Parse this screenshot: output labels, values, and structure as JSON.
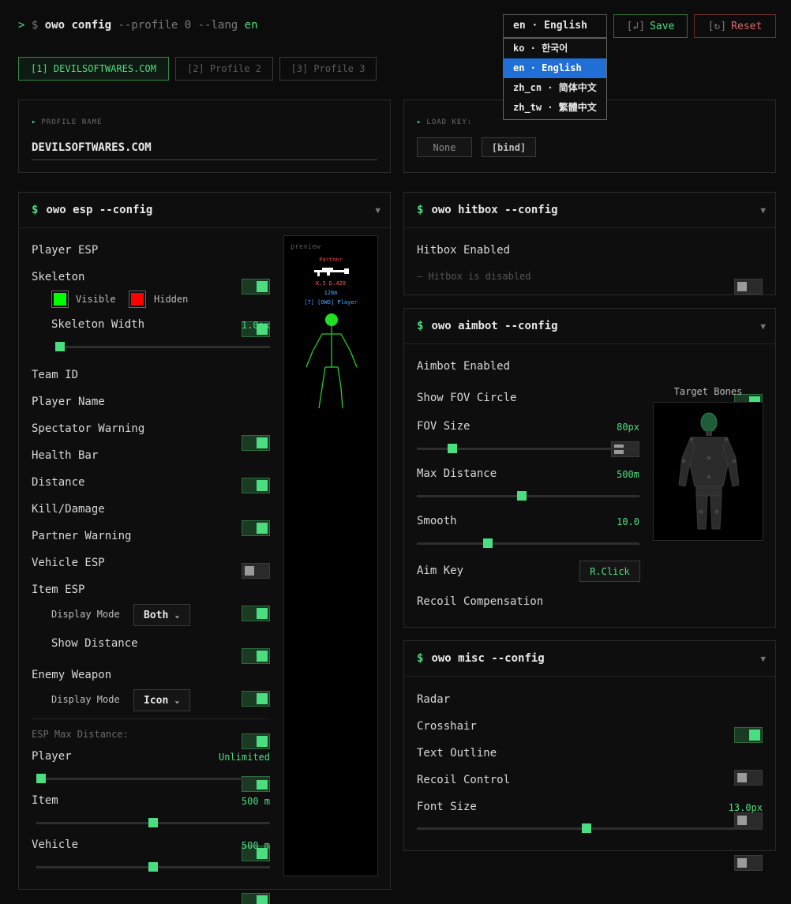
{
  "command": {
    "prompt": ">",
    "dollar": "$",
    "cmd": "owo config",
    "flags": "--profile 0 --lang",
    "lang": "en"
  },
  "language": {
    "current": "en · English",
    "options": [
      {
        "label": "ko · 한국어",
        "selected": false
      },
      {
        "label": "en · English",
        "selected": true
      },
      {
        "label": "zh_cn · 简体中文",
        "selected": false
      },
      {
        "label": "zh_tw · 繁體中文",
        "selected": false
      }
    ]
  },
  "actions": {
    "save_icon": "[↲]",
    "save_label": "Save",
    "reset_icon": "[↻]",
    "reset_label": "Reset"
  },
  "profile_tabs": [
    "[1] DEVILSOFTWARES.COM",
    "[2] Profile 2",
    "[3] Profile 3"
  ],
  "profile": {
    "name_label": "PROFILE NAME",
    "name_value": "DEVILSOFTWARES.COM",
    "load_key_label": "LOAD KEY:",
    "load_key_value": "None",
    "bind_label": "[bind]"
  },
  "esp": {
    "title": "owo esp --config",
    "items": {
      "player_esp": {
        "label": "Player ESP",
        "on": true
      },
      "skeleton": {
        "label": "Skeleton",
        "on": true
      },
      "team_id": {
        "label": "Team ID",
        "on": true
      },
      "player_name": {
        "label": "Player Name",
        "on": true
      },
      "spectator_warning": {
        "label": "Spectator Warning",
        "on": true
      },
      "health_bar": {
        "label": "Health Bar",
        "on": false
      },
      "distance": {
        "label": "Distance",
        "on": true
      },
      "kill_damage": {
        "label": "Kill/Damage",
        "on": true
      },
      "partner_warning": {
        "label": "Partner Warning",
        "on": true
      },
      "vehicle_esp": {
        "label": "Vehicle ESP",
        "on": true
      },
      "item_esp": {
        "label": "Item ESP",
        "on": true
      },
      "show_distance": {
        "label": "Show Distance",
        "on": true
      },
      "enemy_weapon": {
        "label": "Enemy Weapon",
        "on": true
      }
    },
    "visible_label": "Visible",
    "visible_color": "#00ff00",
    "hidden_label": "Hidden",
    "hidden_color": "#ff0000",
    "skeleton_width_label": "Skeleton Width",
    "skeleton_width_value": "1.0px",
    "skeleton_width_fraction": 0.0,
    "display_mode_label": "Display Mode",
    "item_display_mode": "Both",
    "weapon_display_mode": "Icon",
    "max_distance_label": "ESP Max Distance:",
    "player_dist_label": "Player",
    "player_dist_value": "Unlimited",
    "player_dist_fraction": 0.0,
    "item_dist_label": "Item",
    "item_dist_value": "500 m",
    "item_dist_fraction": 0.5,
    "vehicle_dist_label": "Vehicle",
    "vehicle_dist_value": "500 m",
    "vehicle_dist_fraction": 0.5
  },
  "preview": {
    "label": "preview",
    "partner": "Partner",
    "kd": "K.5 D.420",
    "distance": "128m",
    "player": "[7] [OWO] Player"
  },
  "hitbox": {
    "title": "owo hitbox --config",
    "enabled_label": "Hitbox Enabled",
    "enabled": false,
    "status": "— Hitbox is disabled"
  },
  "aimbot": {
    "title": "owo aimbot --config",
    "enabled_label": "Aimbot Enabled",
    "enabled": true,
    "fov_circle_label": "Show FOV Circle",
    "fov_circle": false,
    "fov_size_label": "FOV Size",
    "fov_size_value": "80px",
    "fov_size_fraction": 0.16,
    "max_distance_label": "Max Distance",
    "max_distance_value": "500m",
    "max_distance_fraction": 0.47,
    "smooth_label": "Smooth",
    "smooth_value": "10.0",
    "smooth_fraction": 0.32,
    "aim_key_label": "Aim Key",
    "aim_key_value": "R.Click",
    "recoil_label": "Recoil Compensation",
    "recoil": true,
    "target_bones_label": "Target Bones"
  },
  "misc": {
    "title": "owo misc --config",
    "radar_label": "Radar",
    "radar": true,
    "crosshair_label": "Crosshair",
    "crosshair": false,
    "text_outline_label": "Text Outline",
    "text_outline": false,
    "recoil_control_label": "Recoil Control",
    "recoil_control": false,
    "font_size_label": "Font Size",
    "font_size_value": "13.0px",
    "font_size_fraction": 0.49
  }
}
